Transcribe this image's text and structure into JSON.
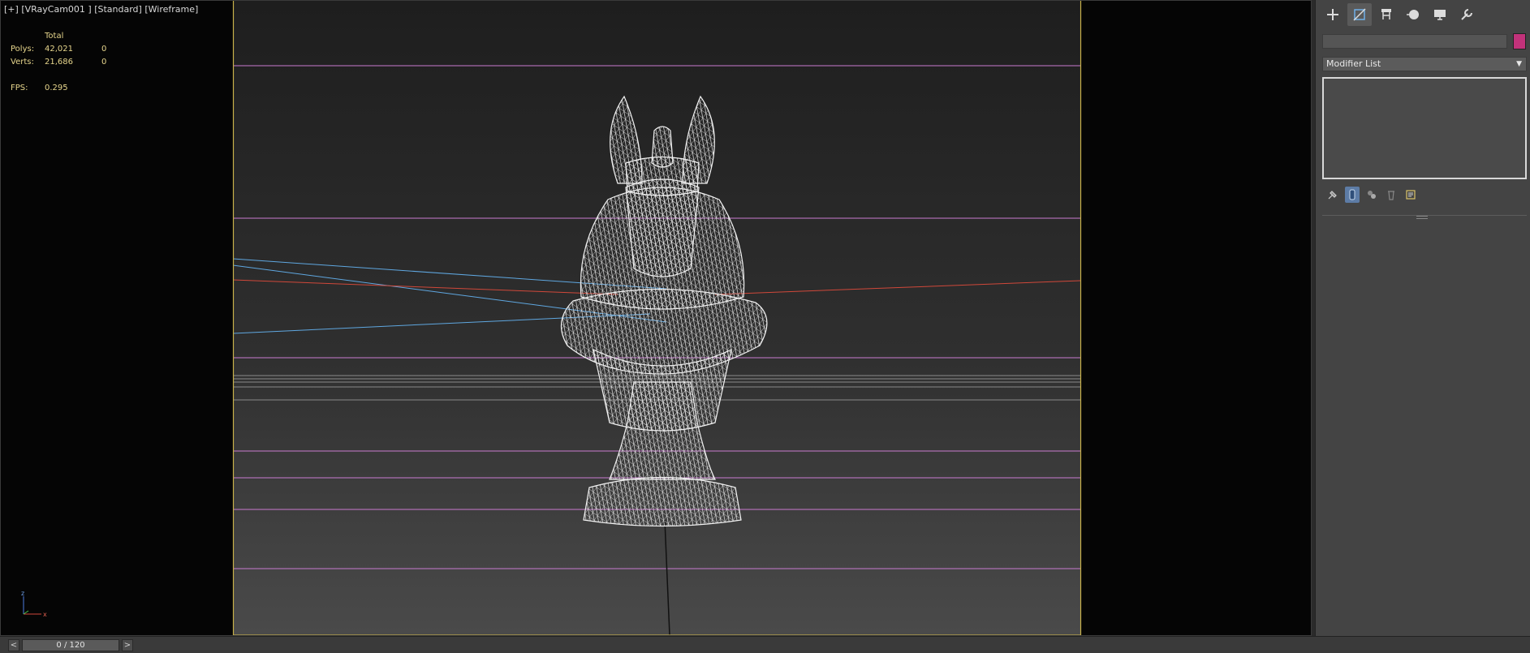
{
  "viewport": {
    "label_plus": "[+]",
    "label_camera": "[VRayCam001 ]",
    "label_shading": "[Standard]",
    "label_mode": "[Wireframe]",
    "stats": {
      "header": "Total",
      "polys_label": "Polys:",
      "polys_total": "42,021",
      "polys_selected": "0",
      "verts_label": "Verts:",
      "verts_total": "21,686",
      "verts_selected": "0",
      "fps_label": "FPS:",
      "fps_value": "0.295"
    },
    "gizmo": {
      "z": "z",
      "x": "x"
    },
    "colors": {
      "safe_frame": "#c8b14a",
      "grid_magenta": "#c97bd0",
      "wire": "#e6e6e6",
      "light_blue": "#5fa7e0",
      "light_red": "#d0483a"
    }
  },
  "command_panel": {
    "tabs": [
      {
        "name": "create",
        "icon": "plus-icon"
      },
      {
        "name": "modify",
        "icon": "modify-icon",
        "active": true
      },
      {
        "name": "hierarchy",
        "icon": "hierarchy-icon"
      },
      {
        "name": "motion",
        "icon": "motion-icon"
      },
      {
        "name": "display",
        "icon": "display-icon"
      },
      {
        "name": "utilities",
        "icon": "wrench-icon"
      }
    ],
    "name_value": "",
    "object_color": "#c2327a",
    "modifier_list_label": "Modifier List",
    "stack_tools": [
      "pin-stack-icon",
      "show-end-result-icon",
      "make-unique-icon",
      "remove-modifier-icon",
      "configure-sets-icon"
    ]
  },
  "timebar": {
    "prev": "<",
    "next": ">",
    "frame_display": "0 / 120",
    "current_frame": 0,
    "total_frames": 120
  }
}
